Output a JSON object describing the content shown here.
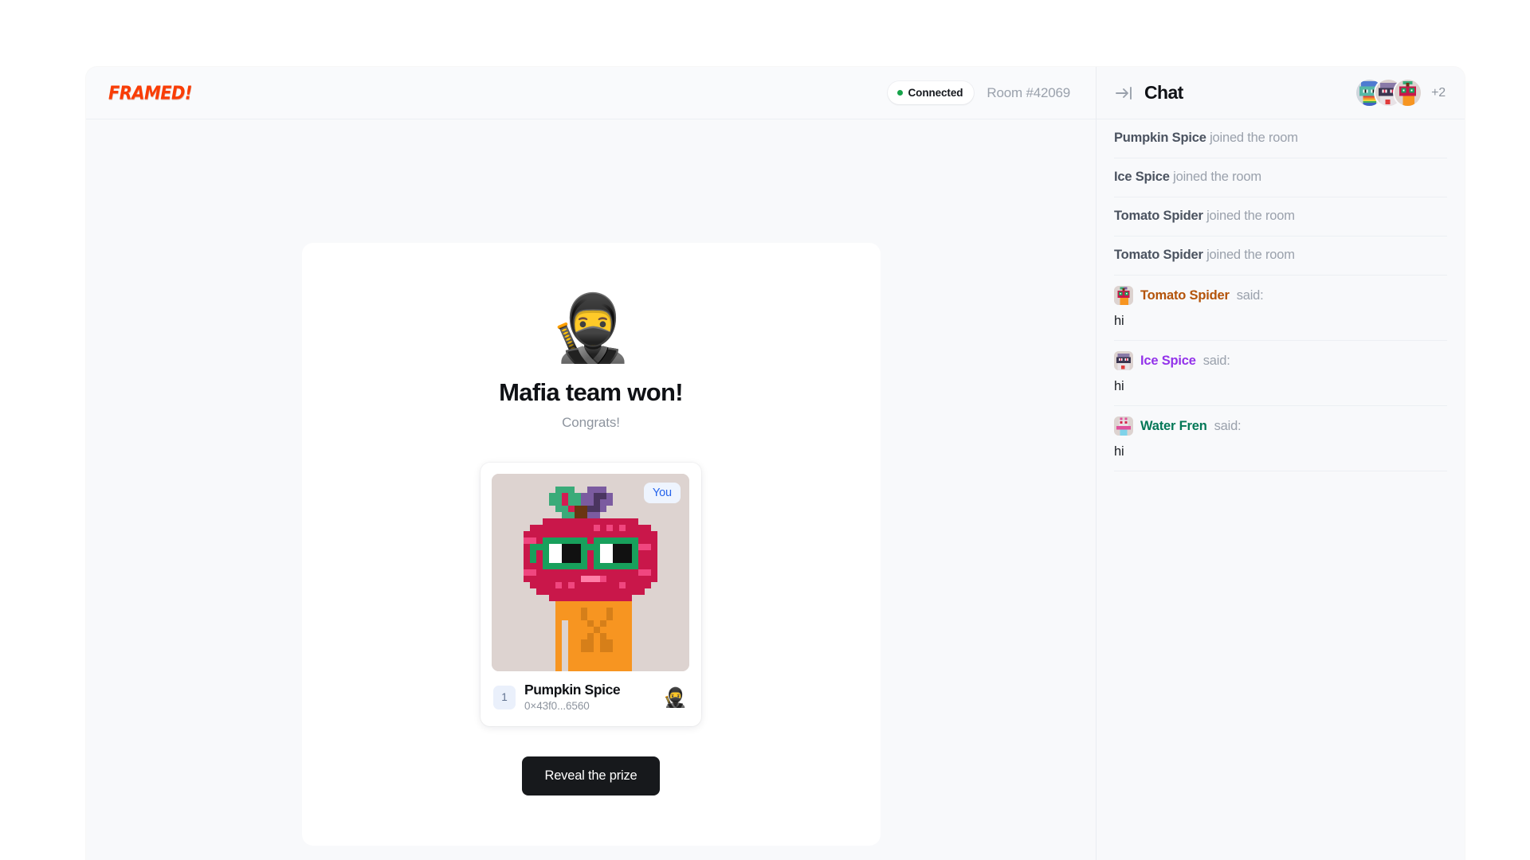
{
  "theme": {
    "page_bg": "#ffffff",
    "app_bg": "#f8f9fb",
    "card_bg": "#ffffff",
    "accent_logo": "#f93d06",
    "accent_connected": "#16a34a",
    "accent_you": "#2563eb",
    "button_bg": "#17191c",
    "divider": "#eceff3"
  },
  "header": {
    "logo_text": "FRAMED!",
    "connection": {
      "label": "Connected",
      "dot_icon": "status-dot-icon",
      "color": "#16a34a"
    },
    "room_label": "Room #42069"
  },
  "game": {
    "winner_emoji": "🥷",
    "winner_emoji_name": "ninja-emoji",
    "title": "Mafia team won!",
    "subtitle": "Congrats!",
    "player_card": {
      "rank": "1",
      "name": "Pumpkin Spice",
      "address": "0×43f0...6560",
      "badge_label": "You",
      "role_emoji": "🥷",
      "role_emoji_name": "ninja-role-emoji",
      "avatar_name": "pumpkin-spice-pixel-avatar"
    },
    "reveal_button_label": "Reveal the prize"
  },
  "chat": {
    "collapse_icon": "collapse-panel-icon",
    "title": "Chat",
    "member_overflow": "+2",
    "members": [
      {
        "name": "Water Fren",
        "avatar_name": "water-fren-avatar"
      },
      {
        "name": "Ice Spice",
        "avatar_name": "ice-spice-avatar"
      },
      {
        "name": "Tomato Spider",
        "avatar_name": "tomato-spider-avatar"
      }
    ],
    "messages": [
      {
        "type": "system",
        "who": "Pumpkin Spice",
        "verb": "joined the room"
      },
      {
        "type": "system",
        "who": "Ice Spice",
        "verb": "joined the room"
      },
      {
        "type": "system",
        "who": "Tomato Spider",
        "verb": "joined the room"
      },
      {
        "type": "system",
        "who": "Tomato Spider",
        "verb": "joined the room"
      },
      {
        "type": "said",
        "who": "Tomato Spider",
        "verb": "said:",
        "text": "hi",
        "color": "#b45309",
        "avatar": "tomato-spider-avatar"
      },
      {
        "type": "said",
        "who": "Ice Spice",
        "verb": "said:",
        "text": "hi",
        "color": "#9333ea",
        "avatar": "ice-spice-avatar"
      },
      {
        "type": "said",
        "who": "Water Fren",
        "verb": "said:",
        "text": "hi",
        "color": "#047857",
        "avatar": "water-fren-avatar"
      }
    ]
  }
}
